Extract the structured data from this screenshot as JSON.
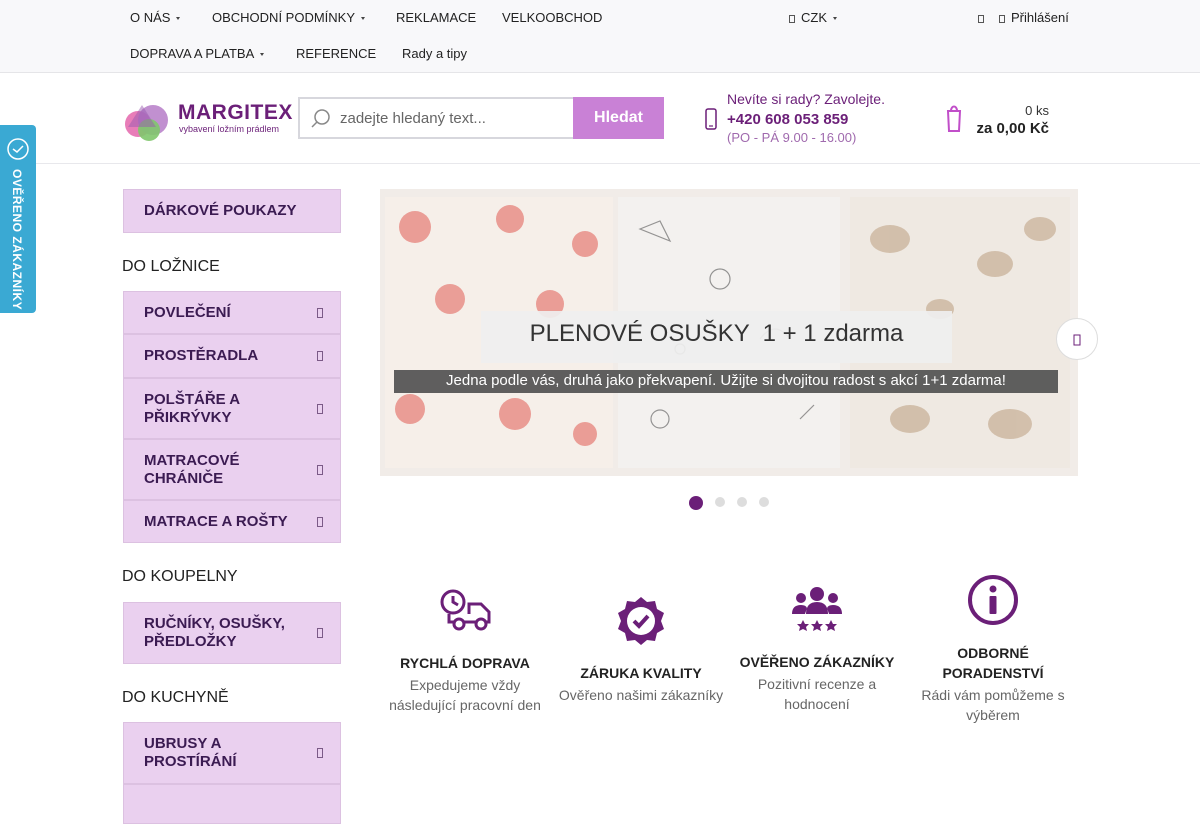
{
  "topnav": {
    "items": [
      {
        "label": "O NÁS",
        "has_caret": true
      },
      {
        "label": "OBCHODNÍ PODMÍNKY",
        "has_caret": true
      },
      {
        "label": "REKLAMACE",
        "has_caret": false
      },
      {
        "label": "VELKOOBCHOD",
        "has_caret": false
      },
      {
        "label": "DOPRAVA A PLATBA",
        "has_caret": true
      },
      {
        "label": "REFERENCE",
        "has_caret": false
      },
      {
        "label": "Rady a tipy",
        "has_caret": false
      }
    ],
    "currency": "CZK",
    "login": "Přihlášení"
  },
  "logo": {
    "name": "MARGITEX",
    "tagline": "vybavení ložním prádlem"
  },
  "search": {
    "placeholder": "zadejte hledaný text...",
    "button": "Hledat"
  },
  "contact": {
    "question": "Nevíte si rady? Zavolejte.",
    "phone": "+420 608 053 859",
    "hours": "(PO - PÁ 9.00 - 16.00)"
  },
  "cart": {
    "count": "0 ks",
    "total": "za 0,00 Kč"
  },
  "verified_tab": "OVĚŘENO ZÁKAZNÍKY",
  "sidebar": {
    "gift": "DÁRKOVÉ POUKAZY",
    "groups": [
      {
        "title": "DO LOŽNICE",
        "items": [
          "POVLEČENÍ",
          "PROSTĚRADLA",
          "POLŠTÁŘE A PŘIKRÝVKY",
          "MATRACOVÉ CHRÁNIČE",
          "MATRACE A ROŠTY"
        ]
      },
      {
        "title": "DO KOUPELNY",
        "items": [
          "RUČNÍKY, OSUŠKY, PŘEDLOŽKY"
        ]
      },
      {
        "title": "DO KUCHYNĚ",
        "items": [
          "UBRUSY A PROSTÍRÁNÍ"
        ]
      }
    ]
  },
  "banner": {
    "headline": "PLENOVÉ OSUŠKY  1 + 1 zdarma",
    "subline": "Jedna podle vás, druhá jako překvapení. Užijte si dvojitou radost s akcí 1+1 zdarma!",
    "slides_total": 4,
    "active_slide": 1
  },
  "features": [
    {
      "title": "RYCHLÁ DOPRAVA",
      "desc": "Expedujeme vždy následující pracovní den",
      "icon": "truck-clock-icon"
    },
    {
      "title": "ZÁRUKA KVALITY",
      "desc": "Ověřeno našimi zákazníky",
      "icon": "check-badge-icon"
    },
    {
      "title": "OVĚŘENO ZÁKAZNÍKY",
      "desc": "Pozitivní recenze a hodnocení",
      "icon": "people-stars-icon"
    },
    {
      "title": "ODBORNÉ PORADENSTVÍ",
      "desc": "Rádi vám pomůžeme s výběrem",
      "icon": "info-circle-icon"
    }
  ],
  "colors": {
    "accent": "#c981d6",
    "brand_purple": "#6b1f78",
    "sidebar_bg": "#ead0ef",
    "verified_blue": "#3aa9d3"
  }
}
